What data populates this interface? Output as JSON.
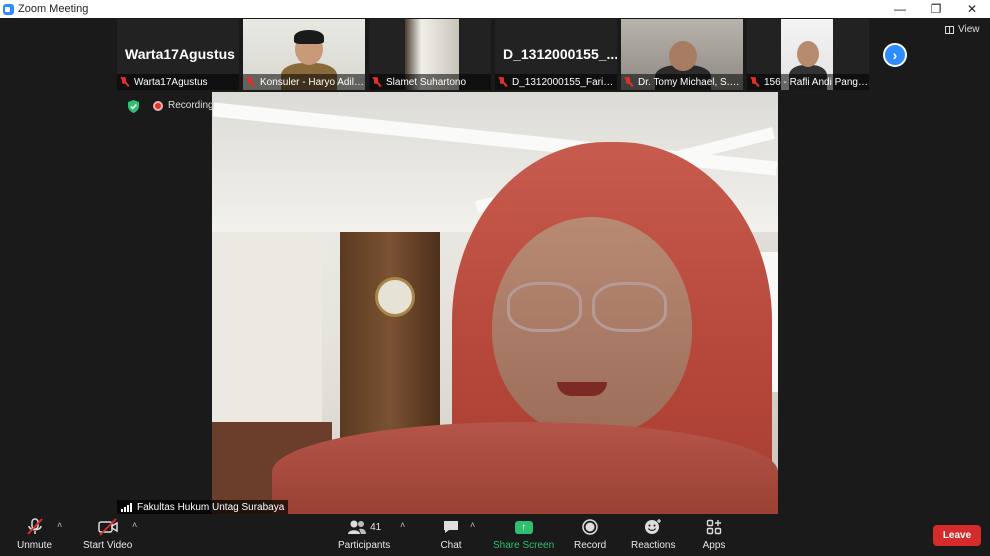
{
  "window": {
    "title": "Zoom Meeting",
    "controls": {
      "minimize": "—",
      "restore": "❐",
      "close": "✕"
    }
  },
  "strip": {
    "thumbnails": [
      {
        "label": "Warta17Agustus",
        "big_name": "Warta17Agustus",
        "muted": true
      },
      {
        "label": "Konsuler - Haryo Adil ...",
        "muted": true
      },
      {
        "label": "Slamet Suhartono",
        "muted": true
      },
      {
        "label": "D_1312000155_Farin ...",
        "big_name": "D_1312000155_...",
        "muted": true
      },
      {
        "label": "Dr. Tomy Michael, S.H., ...",
        "muted": true
      },
      {
        "label": "156 - Rafli Andi Pange...",
        "muted": true
      }
    ],
    "next_icon": "›",
    "view_label": "View"
  },
  "status": {
    "recording_label": "Recording"
  },
  "speaker": {
    "name": "Fakultas Hukum Untag Surabaya"
  },
  "toolbar": {
    "unmute": "Unmute",
    "start_video": "Start Video",
    "participants": "Participants",
    "participants_count": "41",
    "chat": "Chat",
    "share_screen": "Share Screen",
    "record": "Record",
    "reactions": "Reactions",
    "apps": "Apps",
    "leave": "Leave",
    "caret": "˄"
  },
  "colors": {
    "accent": "#2d8cff",
    "share_green": "#2fbf71",
    "leave_red": "#d62b2b",
    "muted_red": "#e0302b"
  }
}
